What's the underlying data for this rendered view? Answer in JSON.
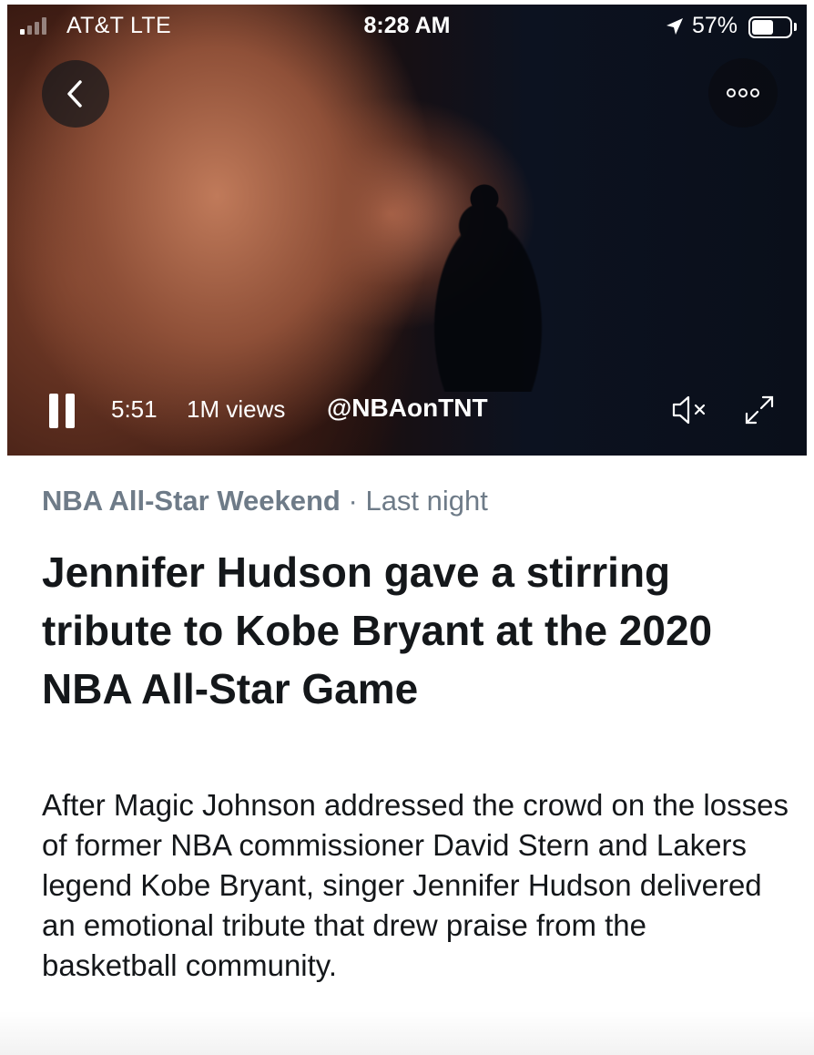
{
  "status_bar": {
    "carrier": "AT&T  LTE",
    "time": "8:28 AM",
    "battery_percent": "57%",
    "battery_level": 0.57,
    "signal_bars_active": 1,
    "signal_bars_total": 4
  },
  "video": {
    "duration": "5:51",
    "views": "1M views",
    "handle": "@NBAonTNT",
    "playing": true,
    "muted": true
  },
  "article": {
    "category": "NBA All-Star Weekend",
    "separator": "·",
    "time": "Last night",
    "headline": "Jennifer Hudson gave a stirring tribute to Kobe Bryant at the 2020 NBA All-Star Game",
    "summary": "After Magic Johnson addressed the crowd on the losses of former NBA commissioner David Stern and Lakers legend Kobe Bryant, singer Jennifer Hudson delivered an emotional tribute that drew praise from the basketball community."
  },
  "icons": {
    "back": "chevron-left-icon",
    "more": "more-horizontal-icon",
    "pause": "pause-icon",
    "mute": "speaker-muted-icon",
    "fullscreen": "expand-icon",
    "location": "location-arrow-icon"
  },
  "colors": {
    "meta_text": "#6e7b88",
    "headline_text": "#14171a",
    "video_overlay_text": "#ffffff"
  }
}
